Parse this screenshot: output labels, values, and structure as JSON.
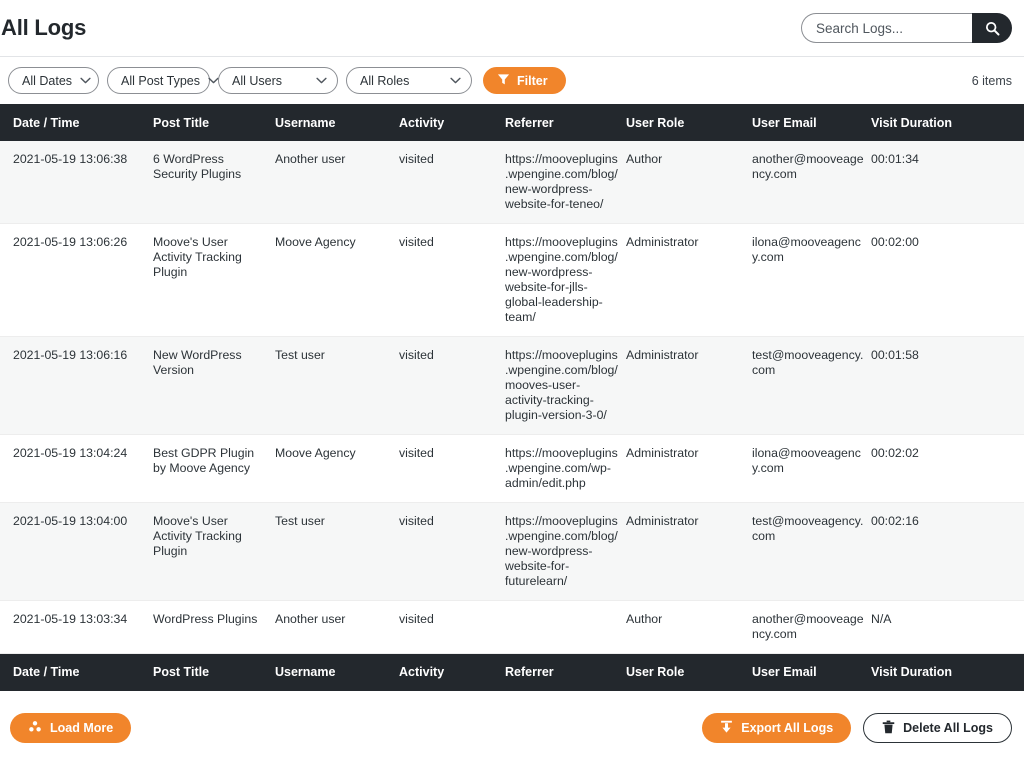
{
  "header": {
    "title": "All Logs",
    "search": {
      "placeholder": "Search Logs...",
      "value": "",
      "button_icon": "search-icon"
    }
  },
  "filters": {
    "dates": {
      "label": "All Dates"
    },
    "post_types": {
      "label": "All Post Types"
    },
    "users": {
      "label": "All Users"
    },
    "roles": {
      "label": "All Roles"
    },
    "filter_button": {
      "label": "Filter",
      "icon": "funnel-icon"
    },
    "items_count": "6 items"
  },
  "table": {
    "columns": [
      "Date / Time",
      "Post Title",
      "Username",
      "Activity",
      "Referrer",
      "User Role",
      "User Email",
      "Visit Duration"
    ],
    "rows": [
      {
        "datetime": "2021-05-19 13:06:38",
        "post_title": "6 WordPress Security Plugins",
        "username": "Another user",
        "activity": "visited",
        "referrer": "https://mooveplugins.wpengine.com/blog/new-wordpress-website-for-teneo/",
        "user_role": "Author",
        "user_email": "another@mooveagency.com",
        "visit_duration": "00:01:34"
      },
      {
        "datetime": "2021-05-19 13:06:26",
        "post_title": "Moove's User Activity Tracking Plugin",
        "username": "Moove Agency",
        "activity": "visited",
        "referrer": "https://mooveplugins.wpengine.com/blog/new-wordpress-website-for-jlls-global-leadership-team/",
        "user_role": "Administrator",
        "user_email": "ilona@mooveagency.com",
        "visit_duration": "00:02:00"
      },
      {
        "datetime": "2021-05-19 13:06:16",
        "post_title": "New WordPress Version",
        "username": "Test user",
        "activity": "visited",
        "referrer": "https://mooveplugins.wpengine.com/blog/mooves-user-activity-tracking-plugin-version-3-0/",
        "user_role": "Administrator",
        "user_email": "test@mooveagency.com",
        "visit_duration": "00:01:58"
      },
      {
        "datetime": "2021-05-19 13:04:24",
        "post_title": "Best GDPR Plugin by Moove Agency",
        "username": "Moove Agency",
        "activity": "visited",
        "referrer": "https://mooveplugins.wpengine.com/wp-admin/edit.php",
        "user_role": "Administrator",
        "user_email": "ilona@mooveagency.com",
        "visit_duration": "00:02:02"
      },
      {
        "datetime": "2021-05-19 13:04:00",
        "post_title": "Moove's User Activity Tracking Plugin",
        "username": "Test user",
        "activity": "visited",
        "referrer": "https://mooveplugins.wpengine.com/blog/new-wordpress-website-for-futurelearn/",
        "user_role": "Administrator",
        "user_email": "test@mooveagency.com",
        "visit_duration": "00:02:16"
      },
      {
        "datetime": "2021-05-19 13:03:34",
        "post_title": "WordPress Plugins",
        "username": "Another user",
        "activity": "visited",
        "referrer": "",
        "user_role": "Author",
        "user_email": "another@mooveagency.com",
        "visit_duration": "N/A"
      }
    ]
  },
  "footer": {
    "load_more": {
      "label": "Load More",
      "icon": "dots-triangle-icon"
    },
    "export": {
      "label": "Export All Logs",
      "icon": "download-icon"
    },
    "delete": {
      "label": "Delete All Logs",
      "icon": "trash-icon"
    }
  },
  "colors": {
    "accent": "#f1852b",
    "header_dark": "#23282d",
    "link": "#3a6ea8",
    "activity_green": "#1a7a34",
    "row_stripe": "#f6f7f7"
  }
}
